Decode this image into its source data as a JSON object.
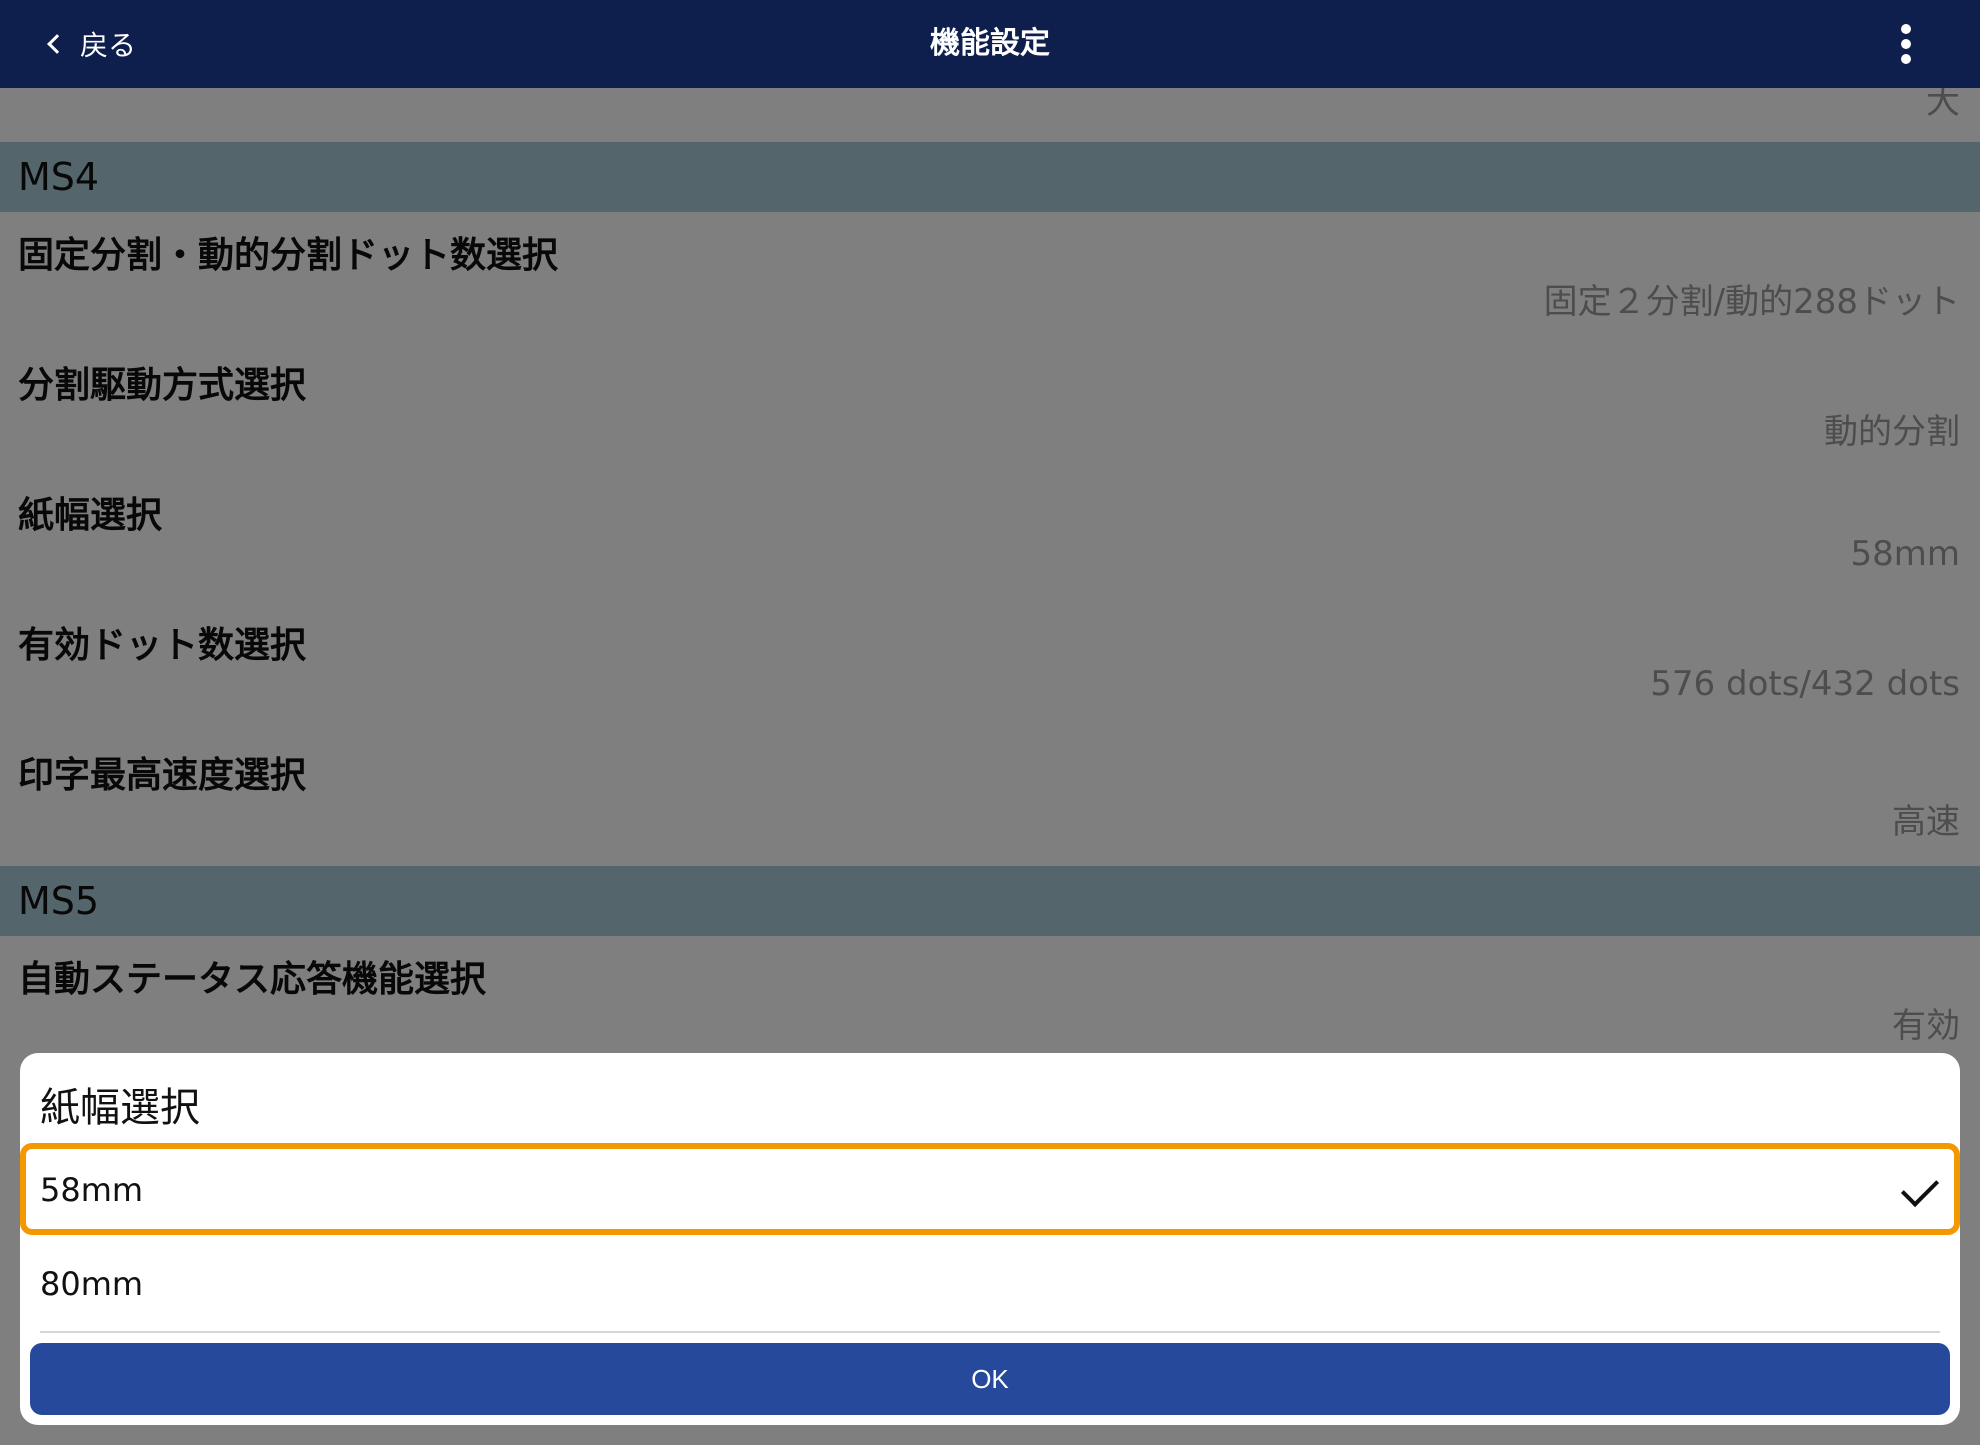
{
  "header": {
    "back_label": "戻る",
    "title": "機能設定",
    "more_icon": "more-vertical-icon"
  },
  "list": {
    "partial_value": "大",
    "sections": [
      {
        "header": "MS4",
        "items": [
          {
            "label": "固定分割・動的分割ドット数選択",
            "value": "固定２分割/動的288ドット"
          },
          {
            "label": "分割駆動方式選択",
            "value": "動的分割"
          },
          {
            "label": "紙幅選択",
            "value": "58mm"
          },
          {
            "label": "有効ドット数選択",
            "value": "576 dots/432 dots"
          },
          {
            "label": "印字最高速度選択",
            "value": "高速"
          }
        ]
      },
      {
        "header": "MS5",
        "items": [
          {
            "label": "自動ステータス応答機能選択",
            "value": "有効"
          }
        ]
      }
    ]
  },
  "dialog": {
    "title": "紙幅選択",
    "options": [
      {
        "label": "58mm",
        "selected": true
      },
      {
        "label": "80mm",
        "selected": false
      }
    ],
    "ok_label": "OK"
  },
  "colors": {
    "navbar": "#0e1f4e",
    "section_header": "#a8cbd6",
    "highlight": "#f39800",
    "ok_button": "#27499c"
  }
}
